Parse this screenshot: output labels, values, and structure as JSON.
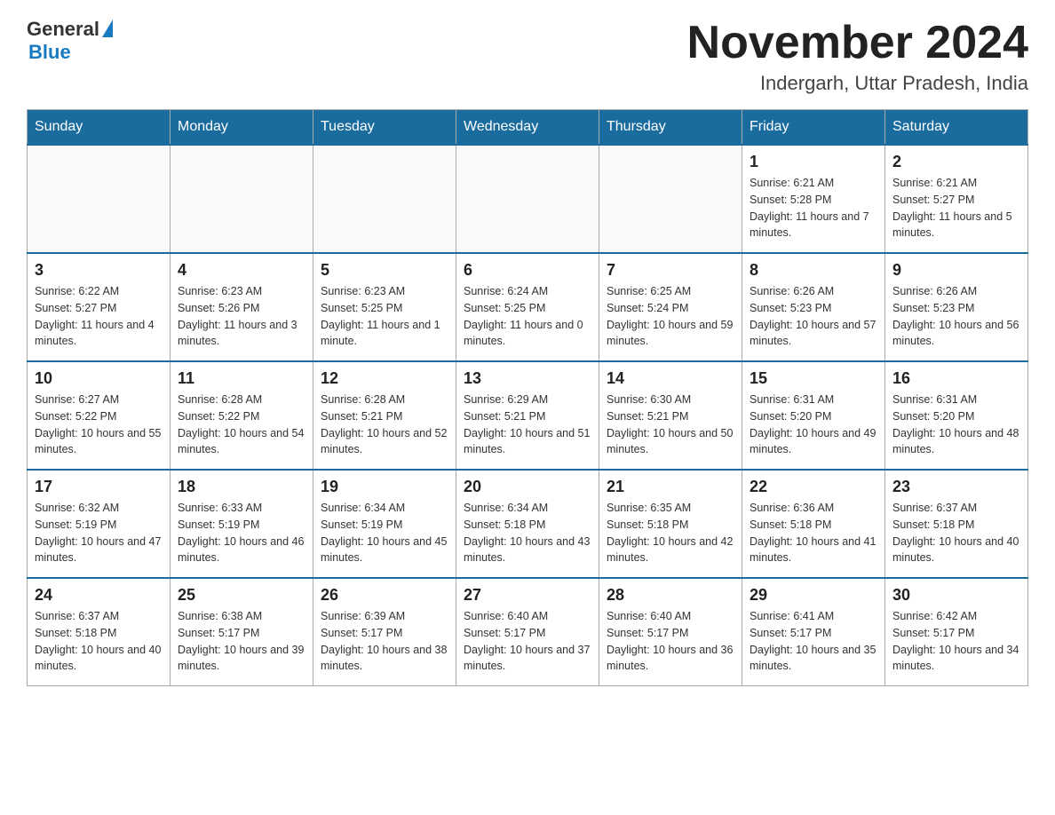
{
  "logo": {
    "general": "General",
    "blue": "Blue"
  },
  "header": {
    "month_year": "November 2024",
    "location": "Indergarh, Uttar Pradesh, India"
  },
  "days_of_week": [
    "Sunday",
    "Monday",
    "Tuesday",
    "Wednesday",
    "Thursday",
    "Friday",
    "Saturday"
  ],
  "weeks": [
    [
      {
        "day": "",
        "info": ""
      },
      {
        "day": "",
        "info": ""
      },
      {
        "day": "",
        "info": ""
      },
      {
        "day": "",
        "info": ""
      },
      {
        "day": "",
        "info": ""
      },
      {
        "day": "1",
        "info": "Sunrise: 6:21 AM\nSunset: 5:28 PM\nDaylight: 11 hours and 7 minutes."
      },
      {
        "day": "2",
        "info": "Sunrise: 6:21 AM\nSunset: 5:27 PM\nDaylight: 11 hours and 5 minutes."
      }
    ],
    [
      {
        "day": "3",
        "info": "Sunrise: 6:22 AM\nSunset: 5:27 PM\nDaylight: 11 hours and 4 minutes."
      },
      {
        "day": "4",
        "info": "Sunrise: 6:23 AM\nSunset: 5:26 PM\nDaylight: 11 hours and 3 minutes."
      },
      {
        "day": "5",
        "info": "Sunrise: 6:23 AM\nSunset: 5:25 PM\nDaylight: 11 hours and 1 minute."
      },
      {
        "day": "6",
        "info": "Sunrise: 6:24 AM\nSunset: 5:25 PM\nDaylight: 11 hours and 0 minutes."
      },
      {
        "day": "7",
        "info": "Sunrise: 6:25 AM\nSunset: 5:24 PM\nDaylight: 10 hours and 59 minutes."
      },
      {
        "day": "8",
        "info": "Sunrise: 6:26 AM\nSunset: 5:23 PM\nDaylight: 10 hours and 57 minutes."
      },
      {
        "day": "9",
        "info": "Sunrise: 6:26 AM\nSunset: 5:23 PM\nDaylight: 10 hours and 56 minutes."
      }
    ],
    [
      {
        "day": "10",
        "info": "Sunrise: 6:27 AM\nSunset: 5:22 PM\nDaylight: 10 hours and 55 minutes."
      },
      {
        "day": "11",
        "info": "Sunrise: 6:28 AM\nSunset: 5:22 PM\nDaylight: 10 hours and 54 minutes."
      },
      {
        "day": "12",
        "info": "Sunrise: 6:28 AM\nSunset: 5:21 PM\nDaylight: 10 hours and 52 minutes."
      },
      {
        "day": "13",
        "info": "Sunrise: 6:29 AM\nSunset: 5:21 PM\nDaylight: 10 hours and 51 minutes."
      },
      {
        "day": "14",
        "info": "Sunrise: 6:30 AM\nSunset: 5:21 PM\nDaylight: 10 hours and 50 minutes."
      },
      {
        "day": "15",
        "info": "Sunrise: 6:31 AM\nSunset: 5:20 PM\nDaylight: 10 hours and 49 minutes."
      },
      {
        "day": "16",
        "info": "Sunrise: 6:31 AM\nSunset: 5:20 PM\nDaylight: 10 hours and 48 minutes."
      }
    ],
    [
      {
        "day": "17",
        "info": "Sunrise: 6:32 AM\nSunset: 5:19 PM\nDaylight: 10 hours and 47 minutes."
      },
      {
        "day": "18",
        "info": "Sunrise: 6:33 AM\nSunset: 5:19 PM\nDaylight: 10 hours and 46 minutes."
      },
      {
        "day": "19",
        "info": "Sunrise: 6:34 AM\nSunset: 5:19 PM\nDaylight: 10 hours and 45 minutes."
      },
      {
        "day": "20",
        "info": "Sunrise: 6:34 AM\nSunset: 5:18 PM\nDaylight: 10 hours and 43 minutes."
      },
      {
        "day": "21",
        "info": "Sunrise: 6:35 AM\nSunset: 5:18 PM\nDaylight: 10 hours and 42 minutes."
      },
      {
        "day": "22",
        "info": "Sunrise: 6:36 AM\nSunset: 5:18 PM\nDaylight: 10 hours and 41 minutes."
      },
      {
        "day": "23",
        "info": "Sunrise: 6:37 AM\nSunset: 5:18 PM\nDaylight: 10 hours and 40 minutes."
      }
    ],
    [
      {
        "day": "24",
        "info": "Sunrise: 6:37 AM\nSunset: 5:18 PM\nDaylight: 10 hours and 40 minutes."
      },
      {
        "day": "25",
        "info": "Sunrise: 6:38 AM\nSunset: 5:17 PM\nDaylight: 10 hours and 39 minutes."
      },
      {
        "day": "26",
        "info": "Sunrise: 6:39 AM\nSunset: 5:17 PM\nDaylight: 10 hours and 38 minutes."
      },
      {
        "day": "27",
        "info": "Sunrise: 6:40 AM\nSunset: 5:17 PM\nDaylight: 10 hours and 37 minutes."
      },
      {
        "day": "28",
        "info": "Sunrise: 6:40 AM\nSunset: 5:17 PM\nDaylight: 10 hours and 36 minutes."
      },
      {
        "day": "29",
        "info": "Sunrise: 6:41 AM\nSunset: 5:17 PM\nDaylight: 10 hours and 35 minutes."
      },
      {
        "day": "30",
        "info": "Sunrise: 6:42 AM\nSunset: 5:17 PM\nDaylight: 10 hours and 34 minutes."
      }
    ]
  ]
}
